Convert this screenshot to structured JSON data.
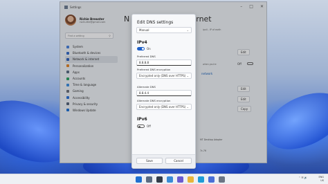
{
  "settings": {
    "title": "Settings",
    "profile": {
      "name": "Richie Brewster",
      "email": "rschurtle@gmail.com"
    },
    "search_placeholder": "Find a setting",
    "page_title_visible": "N",
    "page_title_tail": "rnet",
    "nav": [
      {
        "label": "System",
        "color": "#4a7fd6"
      },
      {
        "label": "Bluetooth & devices",
        "color": "#3a6cc4"
      },
      {
        "label": "Network & internet",
        "color": "#2f5fb8",
        "active": true
      },
      {
        "label": "Personalization",
        "color": "#d9822b"
      },
      {
        "label": "Apps",
        "color": "#5a6b82"
      },
      {
        "label": "Accounts",
        "color": "#2f9e62"
      },
      {
        "label": "Time & language",
        "color": "#3b8ad9"
      },
      {
        "label": "Gaming",
        "color": "#6b6f7a"
      },
      {
        "label": "Accessibility",
        "color": "#2c6fd1"
      },
      {
        "label": "Privacy & security",
        "color": "#566378"
      },
      {
        "label": "Windows Update",
        "color": "#1f6fd0"
      }
    ],
    "right_buttons": {
      "edit1": "Edit",
      "edit2": "Edit",
      "edit3": "Edit",
      "copy": "Copy",
      "off_label": "Off"
    },
    "right_link": "network",
    "adapter_text": "MT Desktop Adapter",
    "right_snippets": [
      "ipv4 -  IP of earth",
      "when you're",
      "7c-76"
    ]
  },
  "dialog": {
    "title": "Edit DNS settings",
    "mode": "Manual",
    "ipv4": {
      "heading": "IPv4",
      "toggle_label": "On",
      "preferred_dns_label": "Preferred DNS",
      "preferred_dns": "8.8.8.8",
      "preferred_enc_label": "Preferred DNS encryption",
      "preferred_enc": "Encrypted only (DNS over HTTPS)",
      "alternate_dns_label": "Alternate DNS",
      "alternate_dns": "8.8.4.4",
      "alternate_enc_label": "Alternate DNS encryption",
      "alternate_enc": "Encrypted only (DNS over HTTPS)"
    },
    "ipv6": {
      "heading": "IPv6",
      "toggle_label": "Off"
    },
    "save": "Save",
    "cancel": "Cancel"
  },
  "taskbar": {
    "icons": [
      {
        "name": "start-icon",
        "color": "#1f6fd0"
      },
      {
        "name": "search-icon",
        "color": "#5a6b82"
      },
      {
        "name": "task-view-icon",
        "color": "#333c4a"
      },
      {
        "name": "widgets-icon",
        "color": "#3a8bd6"
      },
      {
        "name": "chat-icon",
        "color": "#6a5bd0"
      },
      {
        "name": "file-explorer-icon",
        "color": "#e7b53a"
      },
      {
        "name": "edge-icon",
        "color": "#1f9bd6"
      },
      {
        "name": "store-icon",
        "color": "#4a6fd6"
      },
      {
        "name": "settings-icon",
        "color": "#6b7585"
      }
    ],
    "lang": "ENG",
    "region": "US"
  }
}
